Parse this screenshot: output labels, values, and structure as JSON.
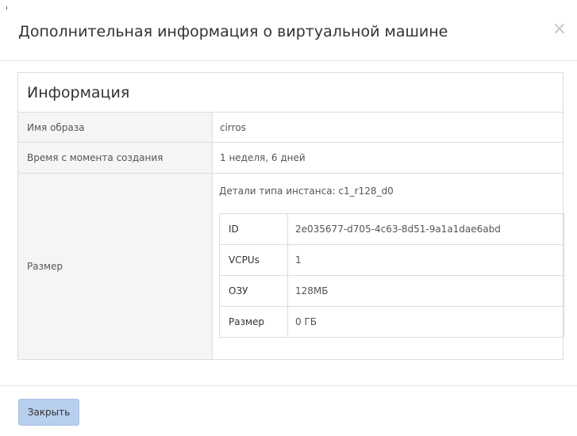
{
  "modal": {
    "title": "Дополнительная информация о виртуальной машине",
    "close_icon": "×"
  },
  "info": {
    "heading": "Информация",
    "rows": [
      {
        "label": "Имя образа",
        "value": "cirros"
      },
      {
        "label": "Время с момента создания",
        "value": "1 неделя, 6 дней"
      },
      {
        "label": "Размер",
        "caption": "Детали типа инстанса: c1_r128_d0"
      }
    ],
    "flavor": [
      {
        "key": "ID",
        "value": "2e035677-d705-4c63-8d51-9a1a1dae6abd"
      },
      {
        "key": "VCPUs",
        "value": "1"
      },
      {
        "key": "ОЗУ",
        "value": "128МБ"
      },
      {
        "key": "Размер",
        "value": "0 ГБ"
      }
    ]
  },
  "footer": {
    "close_label": "Закрыть"
  },
  "colors": {
    "primary_button": "#b8cfee",
    "label_bg": "#f5f5f5",
    "border": "#dddddd"
  }
}
